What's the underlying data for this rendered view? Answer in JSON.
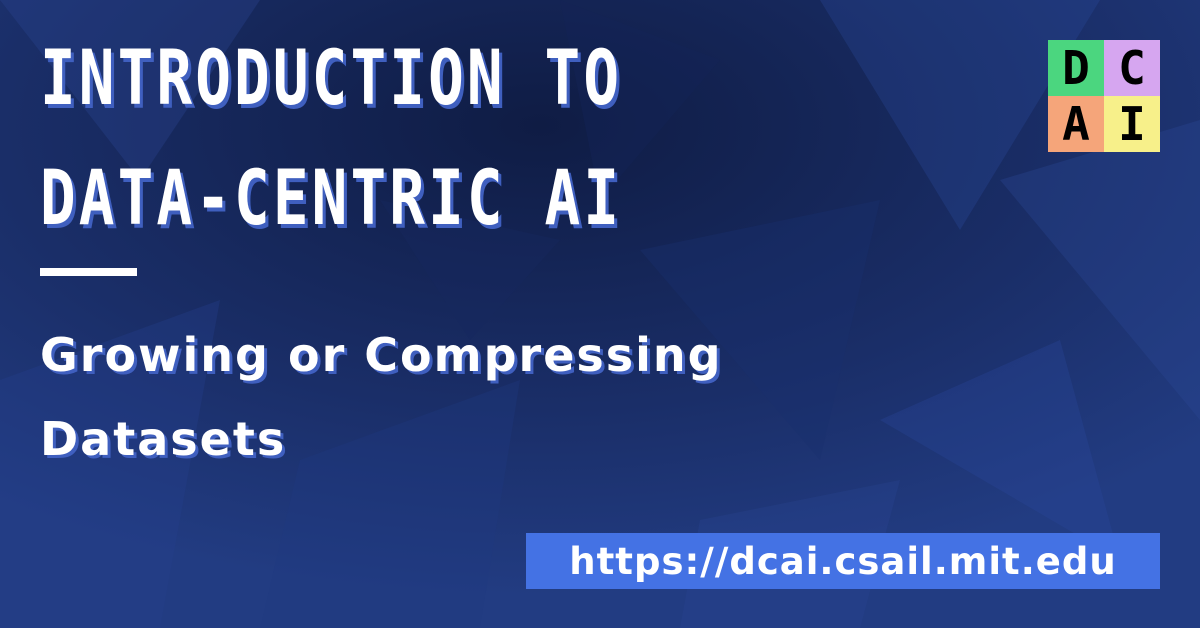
{
  "title": {
    "line1": "INTRODUCTION TO",
    "line2": "DATA-CENTRIC AI"
  },
  "subtitle": {
    "line1": "Growing or Compressing",
    "line2": "Datasets"
  },
  "url": "https://dcai.csail.mit.edu",
  "logo": {
    "cells": [
      {
        "letter": "D",
        "color": "#4bd67f"
      },
      {
        "letter": "C",
        "color": "#d6a6f0"
      },
      {
        "letter": "A",
        "color": "#f5a57a"
      },
      {
        "letter": "I",
        "color": "#f7f08a"
      }
    ]
  },
  "colors": {
    "background": "#1b2f66",
    "accent": "#4472e4",
    "text_shadow": "#3f5fbf"
  }
}
